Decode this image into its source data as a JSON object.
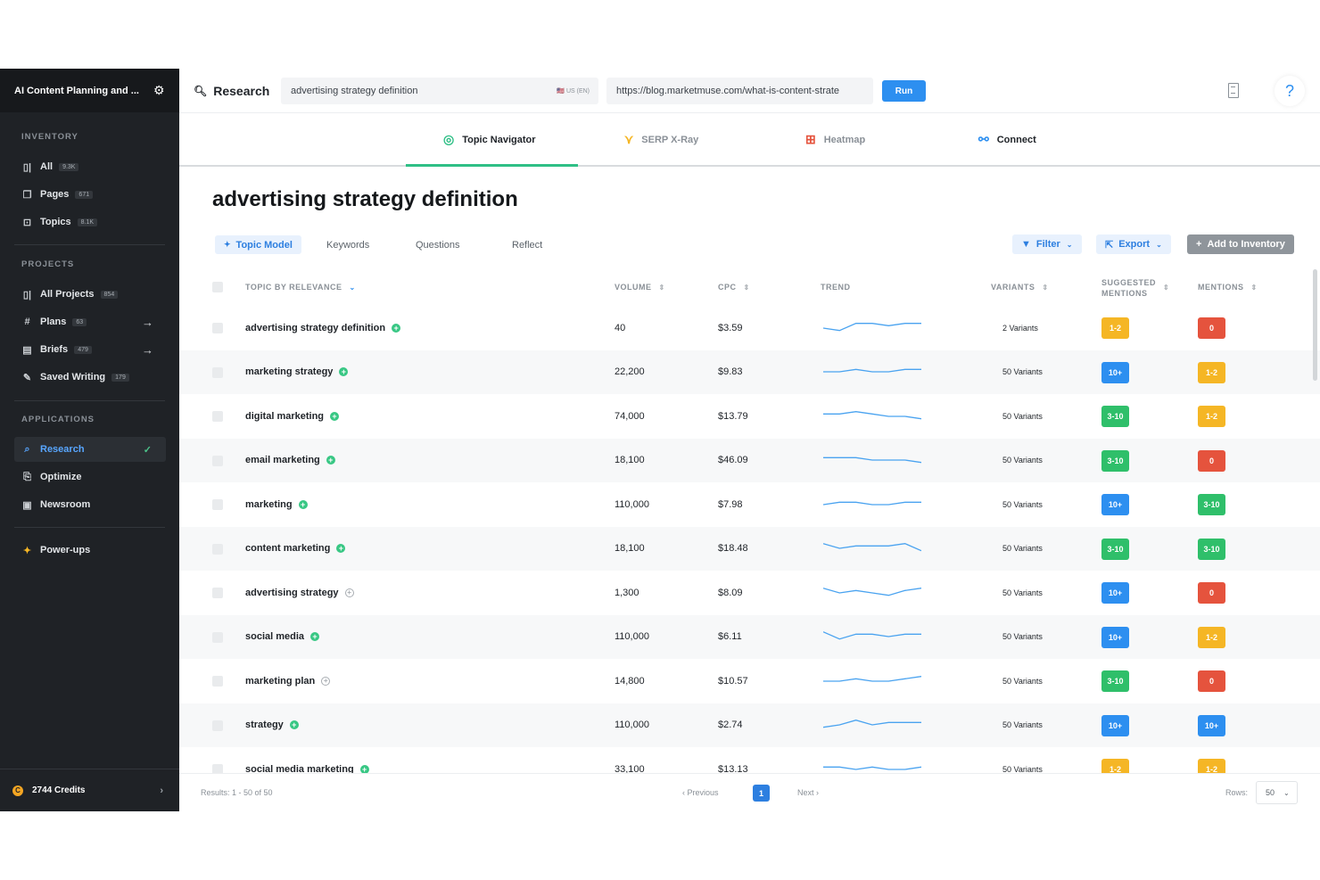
{
  "sidebar": {
    "title": "AI Content Planning and ...",
    "inventory_heading": "INVENTORY",
    "inventory": [
      {
        "label": "All",
        "count": "9.3K"
      },
      {
        "label": "Pages",
        "count": "671"
      },
      {
        "label": "Topics",
        "count": "8.1K"
      }
    ],
    "projects_heading": "PROJECTS",
    "projects": [
      {
        "label": "All Projects",
        "count": "854"
      },
      {
        "label": "Plans",
        "count": "63"
      },
      {
        "label": "Briefs",
        "count": "479"
      },
      {
        "label": "Saved Writing",
        "count": "179"
      }
    ],
    "applications_heading": "APPLICATIONS",
    "applications": [
      {
        "label": "Research"
      },
      {
        "label": "Optimize"
      },
      {
        "label": "Newsroom"
      }
    ],
    "powerups": "Power-ups",
    "credits": "2744 Credits"
  },
  "topbar": {
    "app_label": "Research",
    "query": "advertising strategy definition",
    "locale": "US (EN)",
    "url": "https://blog.marketmuse.com/what-is-content-strate",
    "run_label": "Run",
    "help_label": "?"
  },
  "tool_tabs": [
    "Topic Navigator",
    "SERP X-Ray",
    "Heatmap",
    "Connect"
  ],
  "content": {
    "title": "advertising strategy definition",
    "subtabs": [
      "Topic Model",
      "Keywords",
      "Questions",
      "Reflect"
    ],
    "filter_label": "Filter",
    "export_label": "Export",
    "add_label": "Add to Inventory"
  },
  "table": {
    "headers": {
      "topic": "TOPIC BY RELEVANCE",
      "volume": "VOLUME",
      "cpc": "CPC",
      "trend": "TREND",
      "variants": "VARIANTS",
      "suggested_1": "SUGGESTED",
      "suggested_2": "MENTIONS",
      "mentions": "MENTIONS"
    },
    "rows": [
      {
        "topic": "advertising strategy definition",
        "added": true,
        "volume": "40",
        "cpc": "$3.59",
        "variants": "2 Variants",
        "suggested": "1-2",
        "sug_color": "#f5b625",
        "mentions": "0",
        "men_color": "#e5533d",
        "trend": [
          3,
          2,
          5,
          5,
          4,
          5,
          5
        ]
      },
      {
        "topic": "marketing strategy",
        "added": true,
        "volume": "22,200",
        "cpc": "$9.83",
        "variants": "50 Variants",
        "suggested": "10+",
        "sug_color": "#2d8ff0",
        "mentions": "1-2",
        "men_color": "#f5b625",
        "trend": [
          3,
          3,
          4,
          3,
          3,
          4,
          4
        ]
      },
      {
        "topic": "digital marketing",
        "added": true,
        "volume": "74,000",
        "cpc": "$13.79",
        "variants": "50 Variants",
        "suggested": "3-10",
        "sug_color": "#2fbf6a",
        "mentions": "1-2",
        "men_color": "#f5b625",
        "trend": [
          4,
          4,
          5,
          4,
          3,
          3,
          2
        ]
      },
      {
        "topic": "email marketing",
        "added": true,
        "volume": "18,100",
        "cpc": "$46.09",
        "variants": "50 Variants",
        "suggested": "3-10",
        "sug_color": "#2fbf6a",
        "mentions": "0",
        "men_color": "#e5533d",
        "trend": [
          4,
          4,
          4,
          3,
          3,
          3,
          2
        ]
      },
      {
        "topic": "marketing",
        "added": true,
        "volume": "110,000",
        "cpc": "$7.98",
        "variants": "50 Variants",
        "suggested": "10+",
        "sug_color": "#2d8ff0",
        "mentions": "3-10",
        "men_color": "#2fbf6a",
        "trend": [
          3,
          4,
          4,
          3,
          3,
          4,
          4
        ]
      },
      {
        "topic": "content marketing",
        "added": true,
        "volume": "18,100",
        "cpc": "$18.48",
        "variants": "50 Variants",
        "suggested": "3-10",
        "sug_color": "#2fbf6a",
        "mentions": "3-10",
        "men_color": "#2fbf6a",
        "trend": [
          5,
          3,
          4,
          4,
          4,
          5,
          2
        ]
      },
      {
        "topic": "advertising strategy",
        "added": false,
        "volume": "1,300",
        "cpc": "$8.09",
        "variants": "50 Variants",
        "suggested": "10+",
        "sug_color": "#2d8ff0",
        "mentions": "0",
        "men_color": "#e5533d",
        "trend": [
          5,
          3,
          4,
          3,
          2,
          4,
          5
        ]
      },
      {
        "topic": "social media",
        "added": true,
        "volume": "110,000",
        "cpc": "$6.11",
        "variants": "50 Variants",
        "suggested": "10+",
        "sug_color": "#2d8ff0",
        "mentions": "1-2",
        "men_color": "#f5b625",
        "trend": [
          5,
          2,
          4,
          4,
          3,
          4,
          4
        ]
      },
      {
        "topic": "marketing plan",
        "added": false,
        "volume": "14,800",
        "cpc": "$10.57",
        "variants": "50 Variants",
        "suggested": "3-10",
        "sug_color": "#2fbf6a",
        "mentions": "0",
        "men_color": "#e5533d",
        "trend": [
          3,
          3,
          4,
          3,
          3,
          4,
          5
        ]
      },
      {
        "topic": "strategy",
        "added": true,
        "volume": "110,000",
        "cpc": "$2.74",
        "variants": "50 Variants",
        "suggested": "10+",
        "sug_color": "#2d8ff0",
        "mentions": "10+",
        "men_color": "#2d8ff0",
        "trend": [
          2,
          3,
          5,
          3,
          4,
          4,
          4
        ]
      },
      {
        "topic": "social media marketing",
        "added": true,
        "volume": "33,100",
        "cpc": "$13.13",
        "variants": "50 Variants",
        "suggested": "1-2",
        "sug_color": "#f5b625",
        "mentions": "1-2",
        "men_color": "#f5b625",
        "trend": [
          4,
          4,
          3,
          4,
          3,
          3,
          4
        ]
      }
    ]
  },
  "footer": {
    "results": "Results: 1 - 50 of 50",
    "prev": "Previous",
    "page": "1",
    "next": "Next",
    "rows_label": "Rows:",
    "rows_value": "50"
  }
}
